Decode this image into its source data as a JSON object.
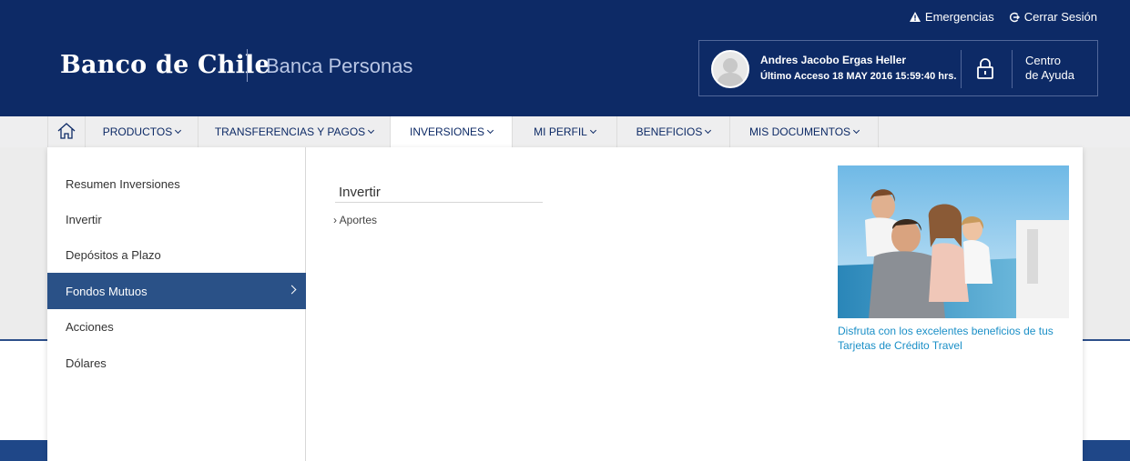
{
  "header": {
    "logo": "Banco de Chile",
    "section": "Banca Personas",
    "links": {
      "emergencias": "Emergencias",
      "cerrar_sesion": "Cerrar Sesión"
    },
    "user": {
      "name": "Andres Jacobo Ergas Heller",
      "last_access": "Último Acceso 18 MAY 2016 15:59:40 hrs."
    },
    "help": {
      "line1": "Centro",
      "line2": "de Ayuda"
    }
  },
  "nav": {
    "items": [
      {
        "label": "PRODUCTOS"
      },
      {
        "label": "TRANSFERENCIAS Y PAGOS"
      },
      {
        "label": "INVERSIONES"
      },
      {
        "label": "MI PERFIL"
      },
      {
        "label": "BENEFICIOS"
      },
      {
        "label": "MIS DOCUMENTOS"
      }
    ]
  },
  "menu": {
    "side_items": [
      {
        "label": "Resumen Inversiones"
      },
      {
        "label": "Invertir"
      },
      {
        "label": "Depósitos a Plazo"
      },
      {
        "label": "Fondos Mutuos"
      },
      {
        "label": "Acciones"
      },
      {
        "label": "Dólares"
      }
    ],
    "active_index": 3,
    "submenu": {
      "title": "Invertir",
      "links": [
        {
          "label": "Aportes"
        }
      ]
    },
    "promo": {
      "text": "Disfruta con los excelentes beneficios de tus Tarjetas de Crédito Travel"
    }
  },
  "colors": {
    "header_bg": "#0d2a66",
    "active_menu_bg": "#2a5187",
    "promo_link": "#1a8fc7"
  }
}
